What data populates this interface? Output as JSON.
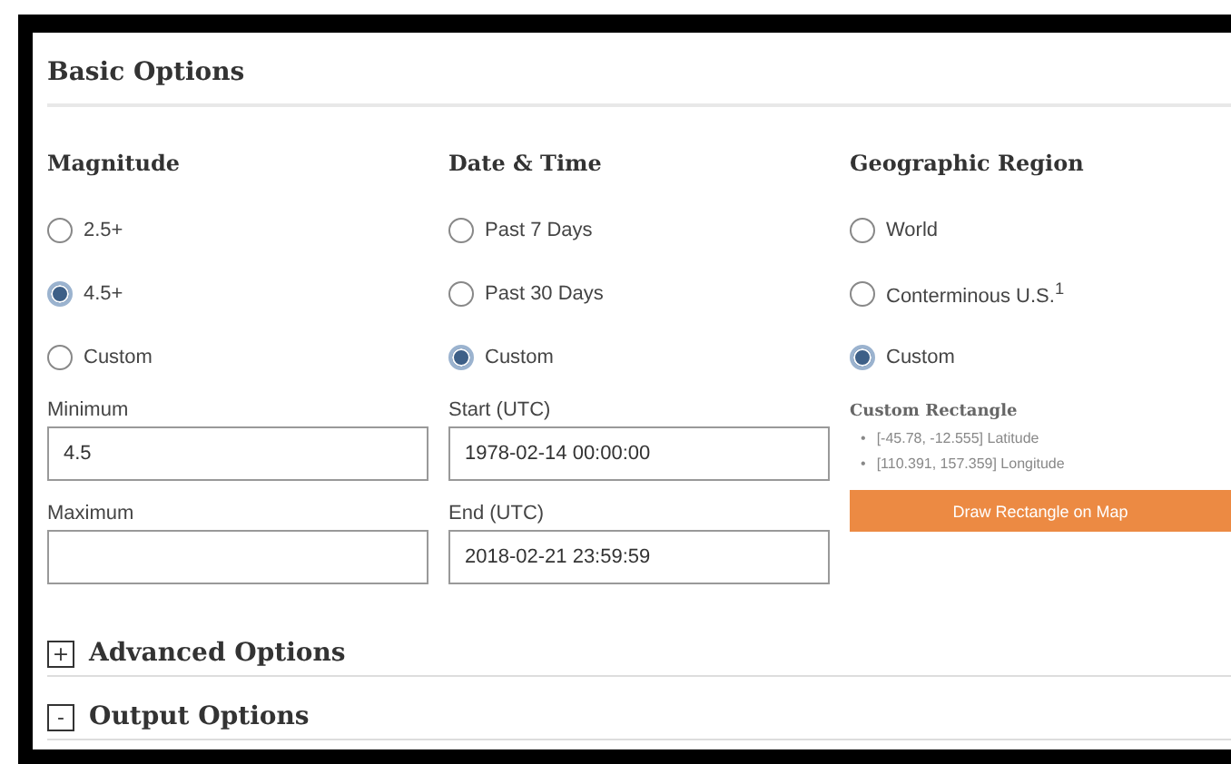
{
  "basic_options": {
    "title": "Basic Options",
    "columns": [
      {
        "title": "Magnitude",
        "options": [
          {
            "label": "2.5+",
            "selected": false
          },
          {
            "label": "4.5+",
            "selected": true
          },
          {
            "label": "Custom",
            "selected": false
          }
        ],
        "fields": [
          {
            "label": "Minimum",
            "value": "4.5"
          },
          {
            "label": "Maximum"
          }
        ]
      },
      {
        "title": "Date & Time",
        "options": [
          {
            "label": "Past 7 Days",
            "selected": false
          },
          {
            "label": "Past 30 Days",
            "selected": false
          },
          {
            "label": "Custom",
            "selected": true
          }
        ],
        "fields": [
          {
            "label": "Start (UTC)",
            "value": "1978-02-14 00:00:00"
          },
          {
            "label": "End (UTC)",
            "value": "2018-02-21 23:59:59"
          }
        ]
      },
      {
        "title": "Geographic Region",
        "options": [
          {
            "label": "World",
            "selected": false
          },
          {
            "label": "Conterminous U.S.$^{1}$",
            "selected": false
          },
          {
            "label": "Custom",
            "selected": true
          }
        ],
        "custom_rectangle": {
          "title": "Custom Rectangle",
          "items": [
            {
              "bullet": "•",
              "text": "[-45.78, -12.555] Latitude"
            },
            {
              "bullet": "•",
              "text": "[110.391, 157.359] Longitude"
            }
          ],
          "button": "Draw Rectangle on Map"
        }
      }
    ]
  },
  "sections": [
    {
      "toggle": "+",
      "title": "Advanced Options"
    },
    {
      "toggle": "-",
      "title": "Output Options"
    }
  ]
}
